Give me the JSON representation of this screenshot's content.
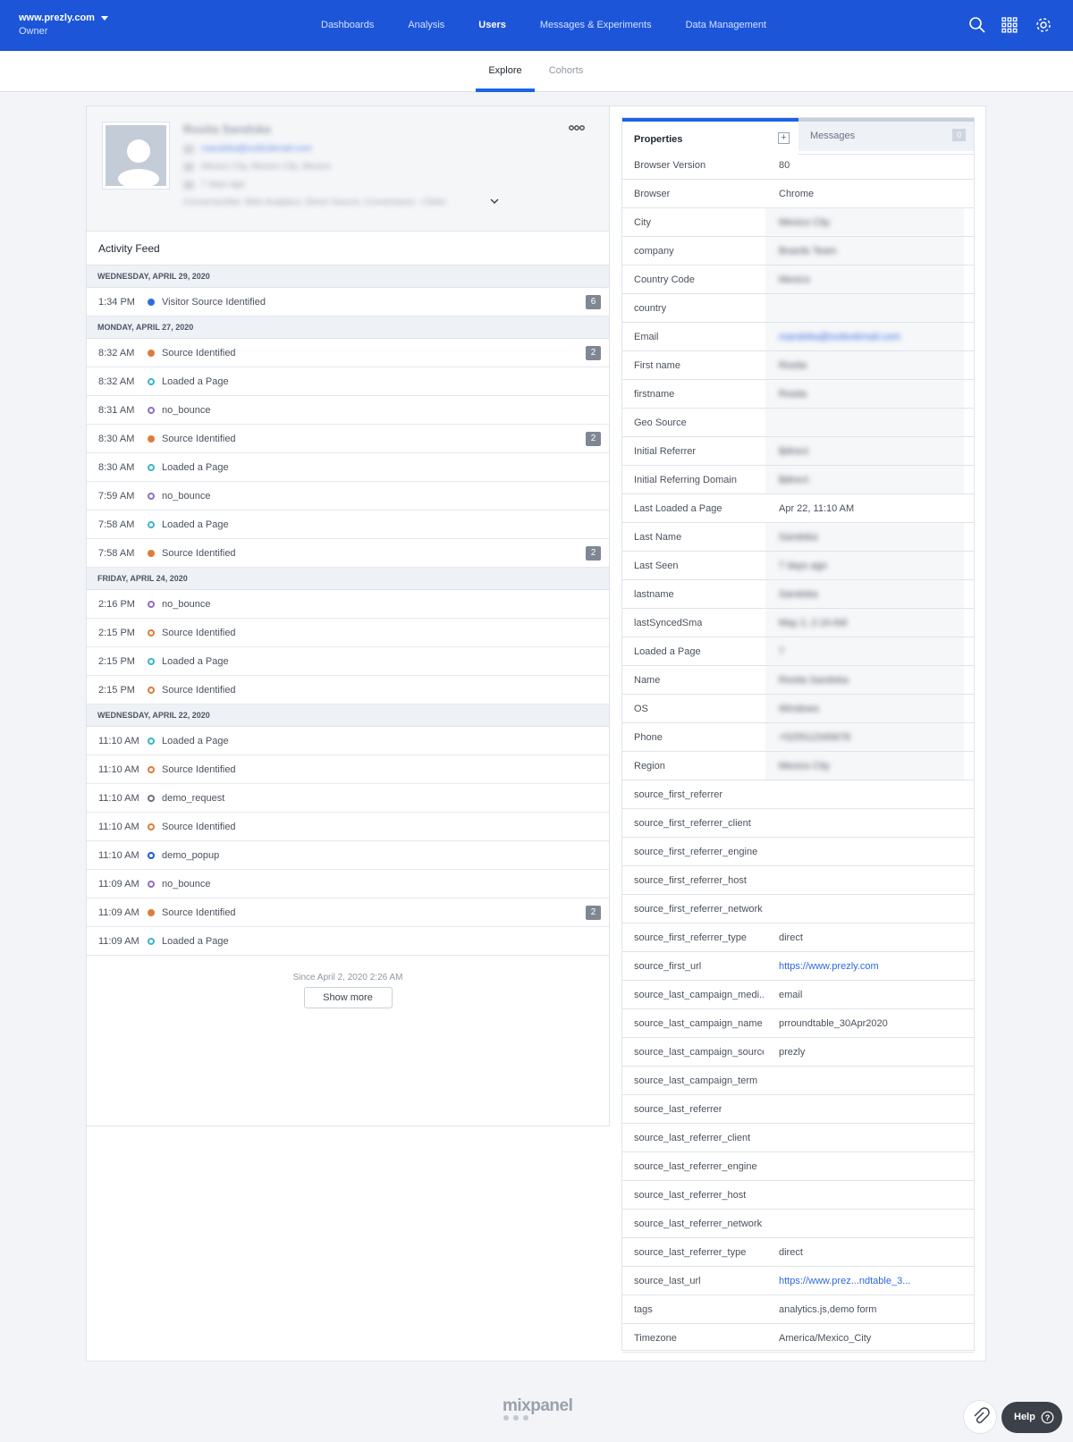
{
  "header": {
    "project": "www.prezly.com",
    "role": "Owner",
    "nav": [
      "Dashboards",
      "Analysis",
      "Users",
      "Messages & Experiments",
      "Data Management"
    ],
    "active_nav": "Users",
    "brand_color": "#1c55d8"
  },
  "subnav": {
    "tabs": [
      "Explore",
      "Cohorts"
    ],
    "active": "Explore"
  },
  "profile": {
    "name": "Rosita Sandoka",
    "email": "rsandoka@outlookmail.com",
    "location": "Mexico City, Mexico City, Mexico",
    "last_seen": "7 days ago",
    "segments": "Conversionlist, Web Analytics, Direct Source, Conversions - Clicks"
  },
  "activity": {
    "title": "Activity Feed",
    "groups": [
      {
        "date": "WEDNESDAY, APRIL 29, 2020",
        "events": [
          {
            "time": "1:34 PM",
            "name": "Visitor Source Identified",
            "dot": "#2f6de1",
            "ring": false,
            "count": "6"
          }
        ]
      },
      {
        "date": "MONDAY, APRIL 27, 2020",
        "events": [
          {
            "time": "8:32 AM",
            "name": "Source Identified",
            "dot": "#e07b39",
            "ring": false,
            "count": "2"
          },
          {
            "time": "8:32 AM",
            "name": "Loaded a Page",
            "dot": "#3bb5c6",
            "ring": true,
            "count": ""
          },
          {
            "time": "8:31 AM",
            "name": "no_bounce",
            "dot": "#8f6fc0",
            "ring": true,
            "count": ""
          },
          {
            "time": "8:30 AM",
            "name": "Source Identified",
            "dot": "#e07b39",
            "ring": false,
            "count": "2"
          },
          {
            "time": "8:30 AM",
            "name": "Loaded a Page",
            "dot": "#3bb5c6",
            "ring": true,
            "count": ""
          },
          {
            "time": "7:59 AM",
            "name": "no_bounce",
            "dot": "#8f6fc0",
            "ring": true,
            "count": ""
          },
          {
            "time": "7:58 AM",
            "name": "Loaded a Page",
            "dot": "#3bb5c6",
            "ring": true,
            "count": ""
          },
          {
            "time": "7:58 AM",
            "name": "Source Identified",
            "dot": "#e07b39",
            "ring": false,
            "count": "2"
          }
        ]
      },
      {
        "date": "FRIDAY, APRIL 24, 2020",
        "events": [
          {
            "time": "2:16 PM",
            "name": "no_bounce",
            "dot": "#8f6fc0",
            "ring": true,
            "count": ""
          },
          {
            "time": "2:15 PM",
            "name": "Source Identified",
            "dot": "#e07b39",
            "ring": true,
            "count": ""
          },
          {
            "time": "2:15 PM",
            "name": "Loaded a Page",
            "dot": "#3bb5c6",
            "ring": true,
            "count": ""
          },
          {
            "time": "2:15 PM",
            "name": "Source Identified",
            "dot": "#e07b39",
            "ring": true,
            "count": ""
          }
        ]
      },
      {
        "date": "WEDNESDAY, APRIL 22, 2020",
        "events": [
          {
            "time": "11:10 AM",
            "name": "Loaded a Page",
            "dot": "#3bb5c6",
            "ring": true,
            "count": ""
          },
          {
            "time": "11:10 AM",
            "name": "Source Identified",
            "dot": "#e07b39",
            "ring": true,
            "count": ""
          },
          {
            "time": "11:10 AM",
            "name": "demo_request",
            "dot": "#6b7380",
            "ring": true,
            "count": ""
          },
          {
            "time": "11:10 AM",
            "name": "Source Identified",
            "dot": "#e07b39",
            "ring": true,
            "count": ""
          },
          {
            "time": "11:10 AM",
            "name": "demo_popup",
            "dot": "#1c55d8",
            "ring": true,
            "count": ""
          },
          {
            "time": "11:09 AM",
            "name": "no_bounce",
            "dot": "#8f6fc0",
            "ring": true,
            "count": ""
          },
          {
            "time": "11:09 AM",
            "name": "Source Identified",
            "dot": "#e07b39",
            "ring": false,
            "count": "2"
          },
          {
            "time": "11:09 AM",
            "name": "Loaded a Page",
            "dot": "#3bb5c6",
            "ring": true,
            "count": ""
          }
        ]
      }
    ],
    "since": "Since April 2, 2020 2:26 AM",
    "show_more": "Show more"
  },
  "properties": {
    "tabs": [
      "Properties",
      "Messages"
    ],
    "messages_count": "0",
    "rows": [
      {
        "key": "Browser Version",
        "value": "80",
        "blurred": false,
        "link": false
      },
      {
        "key": "Browser",
        "value": "Chrome",
        "blurred": false,
        "link": false
      },
      {
        "key": "City",
        "value": "Mexico City",
        "blurred": true,
        "link": false
      },
      {
        "key": "company",
        "value": "Boards Team",
        "blurred": true,
        "link": false
      },
      {
        "key": "Country Code",
        "value": "Mexico",
        "blurred": true,
        "link": false
      },
      {
        "key": "country",
        "value": "",
        "blurred": true,
        "link": false
      },
      {
        "key": "Email",
        "value": "rsandoka@outlookmail.com",
        "blurred": true,
        "link": true
      },
      {
        "key": "First name",
        "value": "Rosita",
        "blurred": true,
        "link": false
      },
      {
        "key": "firstname",
        "value": "Rosita",
        "blurred": true,
        "link": false
      },
      {
        "key": "Geo Source",
        "value": "",
        "blurred": true,
        "link": false
      },
      {
        "key": "Initial Referrer",
        "value": "$direct",
        "blurred": true,
        "link": false
      },
      {
        "key": "Initial Referring Domain",
        "value": "$direct",
        "blurred": true,
        "link": false
      },
      {
        "key": "Last Loaded a Page",
        "value": "Apr 22, 11:10 AM",
        "blurred": false,
        "link": false
      },
      {
        "key": "Last Name",
        "value": "Sandoka",
        "blurred": true,
        "link": false
      },
      {
        "key": "Last Seen",
        "value": "7 days ago",
        "blurred": true,
        "link": false
      },
      {
        "key": "lastname",
        "value": "Sandoka",
        "blurred": true,
        "link": false
      },
      {
        "key": "lastSyncedSma",
        "value": "May 2, 2:19 AM",
        "blurred": true,
        "link": false
      },
      {
        "key": "Loaded a Page",
        "value": "7",
        "blurred": true,
        "link": false
      },
      {
        "key": "Name",
        "value": "Rosita Sandoka",
        "blurred": true,
        "link": false
      },
      {
        "key": "OS",
        "value": "Windows",
        "blurred": true,
        "link": false
      },
      {
        "key": "Phone",
        "value": "+525512345678",
        "blurred": true,
        "link": false
      },
      {
        "key": "Region",
        "value": "Mexico City",
        "blurred": true,
        "link": false
      },
      {
        "key": "source_first_referrer",
        "value": "",
        "blurred": false,
        "link": false
      },
      {
        "key": "source_first_referrer_client",
        "value": "",
        "blurred": false,
        "link": false
      },
      {
        "key": "source_first_referrer_engine",
        "value": "",
        "blurred": false,
        "link": false
      },
      {
        "key": "source_first_referrer_host",
        "value": "",
        "blurred": false,
        "link": false
      },
      {
        "key": "source_first_referrer_network",
        "value": "",
        "blurred": false,
        "link": false
      },
      {
        "key": "source_first_referrer_type",
        "value": "direct",
        "blurred": false,
        "link": false
      },
      {
        "key": "source_first_url",
        "value": "https://www.prezly.com",
        "blurred": false,
        "link": true
      },
      {
        "key": "source_last_campaign_medi...",
        "value": "email",
        "blurred": false,
        "link": false
      },
      {
        "key": "source_last_campaign_name",
        "value": "prroundtable_30Apr2020",
        "blurred": false,
        "link": false
      },
      {
        "key": "source_last_campaign_source",
        "value": "prezly",
        "blurred": false,
        "link": false
      },
      {
        "key": "source_last_campaign_term",
        "value": "",
        "blurred": false,
        "link": false
      },
      {
        "key": "source_last_referrer",
        "value": "",
        "blurred": false,
        "link": false
      },
      {
        "key": "source_last_referrer_client",
        "value": "",
        "blurred": false,
        "link": false
      },
      {
        "key": "source_last_referrer_engine",
        "value": "",
        "blurred": false,
        "link": false
      },
      {
        "key": "source_last_referrer_host",
        "value": "",
        "blurred": false,
        "link": false
      },
      {
        "key": "source_last_referrer_network",
        "value": "",
        "blurred": false,
        "link": false
      },
      {
        "key": "source_last_referrer_type",
        "value": "direct",
        "blurred": false,
        "link": false
      },
      {
        "key": "source_last_url",
        "value": "https://www.prez...ndtable_3...",
        "blurred": false,
        "link": true
      },
      {
        "key": "tags",
        "value": "analytics.js,demo form",
        "blurred": false,
        "link": false
      },
      {
        "key": "Timezone",
        "value": "America/Mexico_City",
        "blurred": false,
        "link": false
      }
    ]
  },
  "footer": {
    "logo": "mixpanel",
    "help": "Help"
  }
}
